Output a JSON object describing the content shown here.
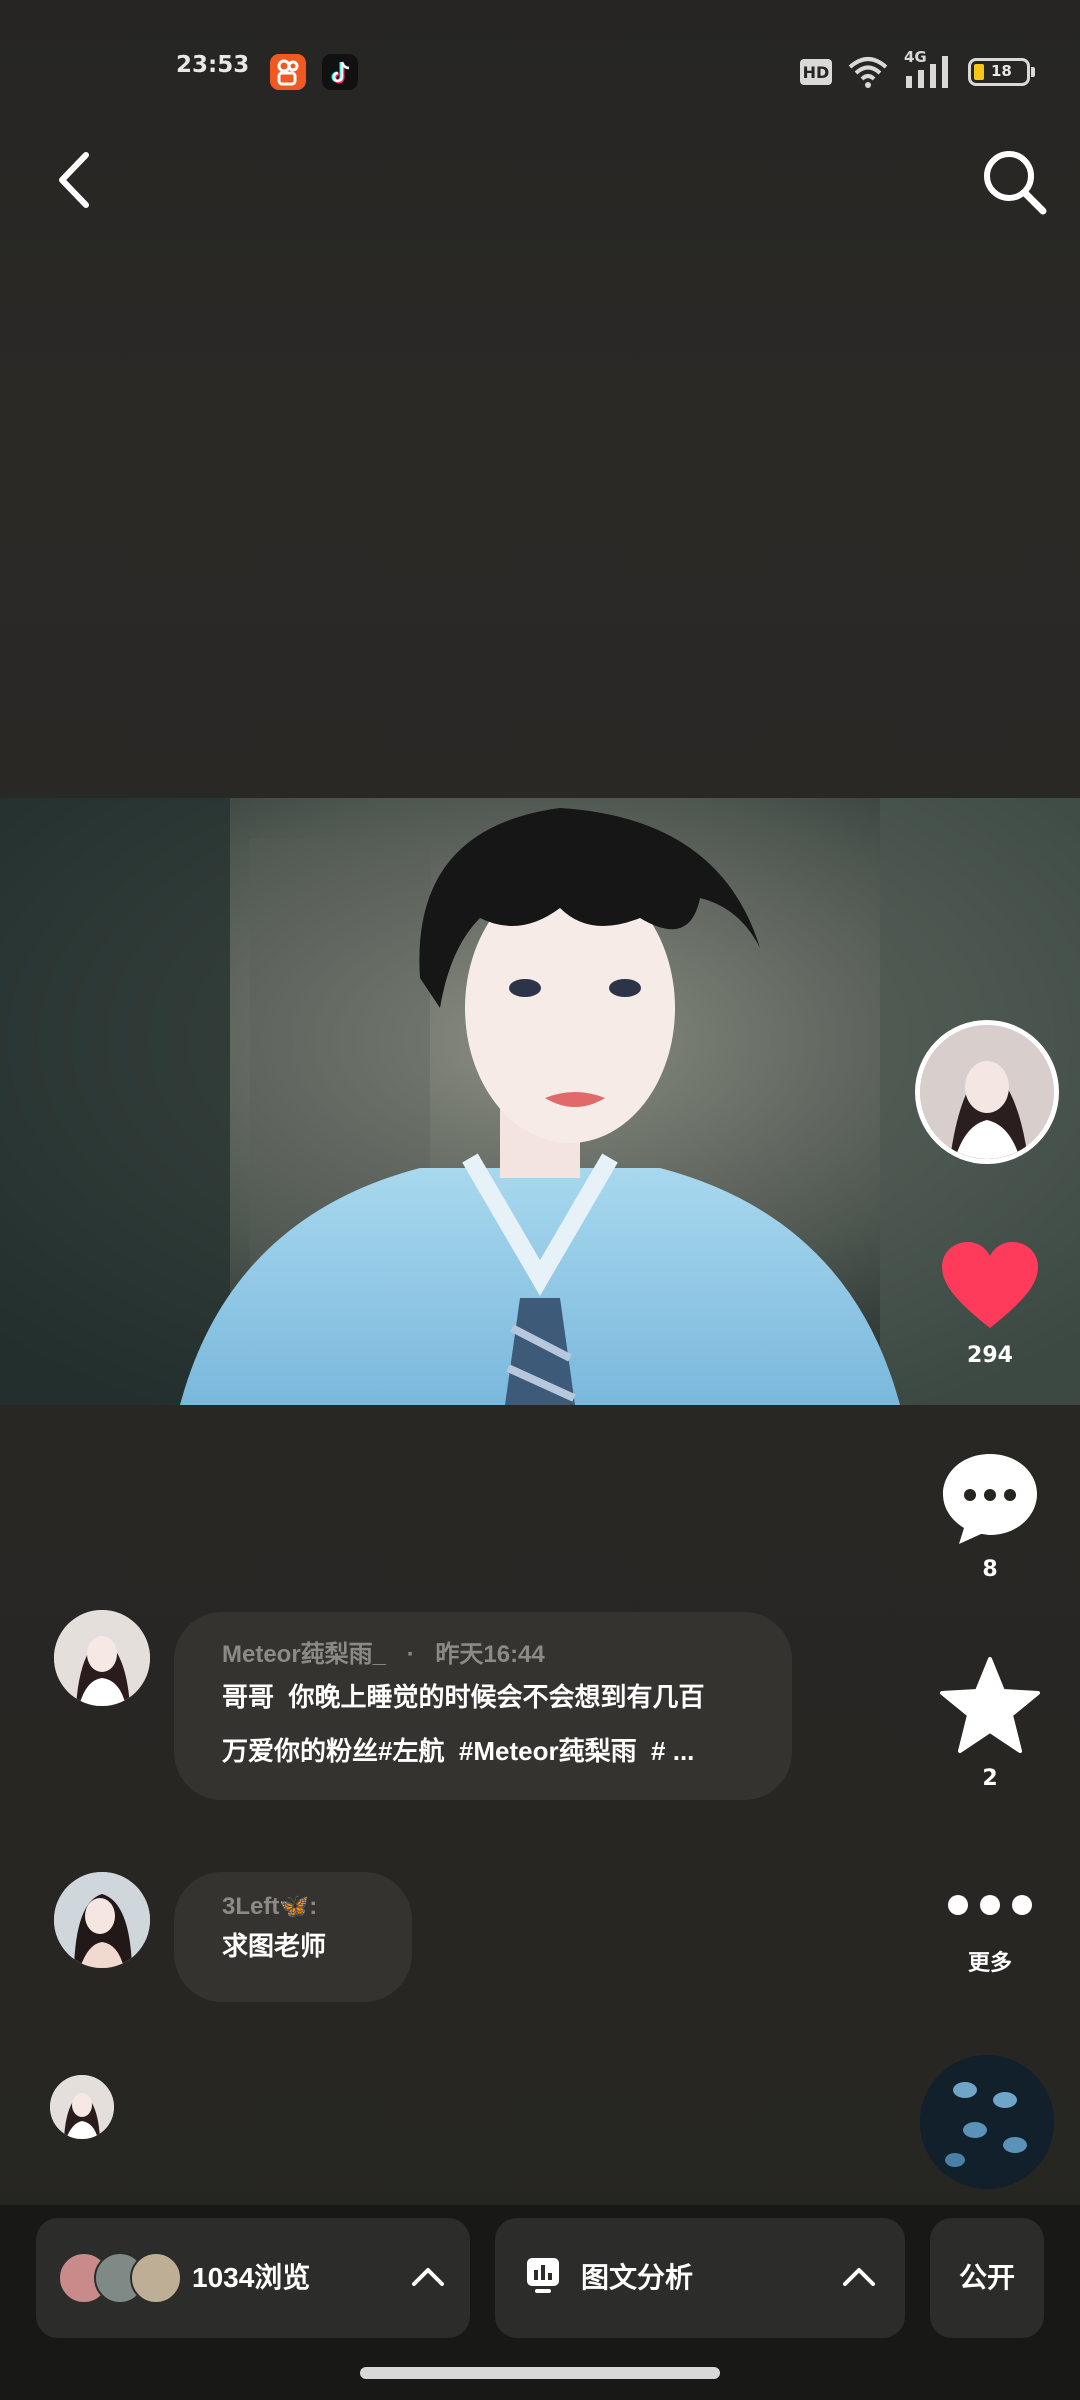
{
  "status_bar": {
    "time": "23:53",
    "hd": "HD",
    "network": "4G",
    "battery": "18",
    "icons": [
      "kuaishou-app-icon",
      "tiktok-app-icon",
      "wifi-icon",
      "signal-icon",
      "battery-icon"
    ]
  },
  "nav": {
    "back_icon": "chevron-left-icon",
    "search_icon": "search-icon"
  },
  "actions": {
    "like_count": "294",
    "comment_count": "8",
    "favorite_count": "2",
    "more_label": "更多",
    "like_color": "#ff3b5c"
  },
  "comments": [
    {
      "user": "Meteor莼梨雨_",
      "separator": "·",
      "time": "昨天16:44",
      "text_line1": "哥哥  你晚上睡觉的时候会不会想到有几百",
      "text_line2": "万爱你的粉丝#左航  #Meteor莼梨雨  # ..."
    },
    {
      "user": "3Left🦋",
      "separator": ":",
      "text": "求图老师"
    }
  ],
  "bottom": {
    "views": "1034浏览",
    "analysis": "图文分析",
    "visibility": "公开"
  }
}
